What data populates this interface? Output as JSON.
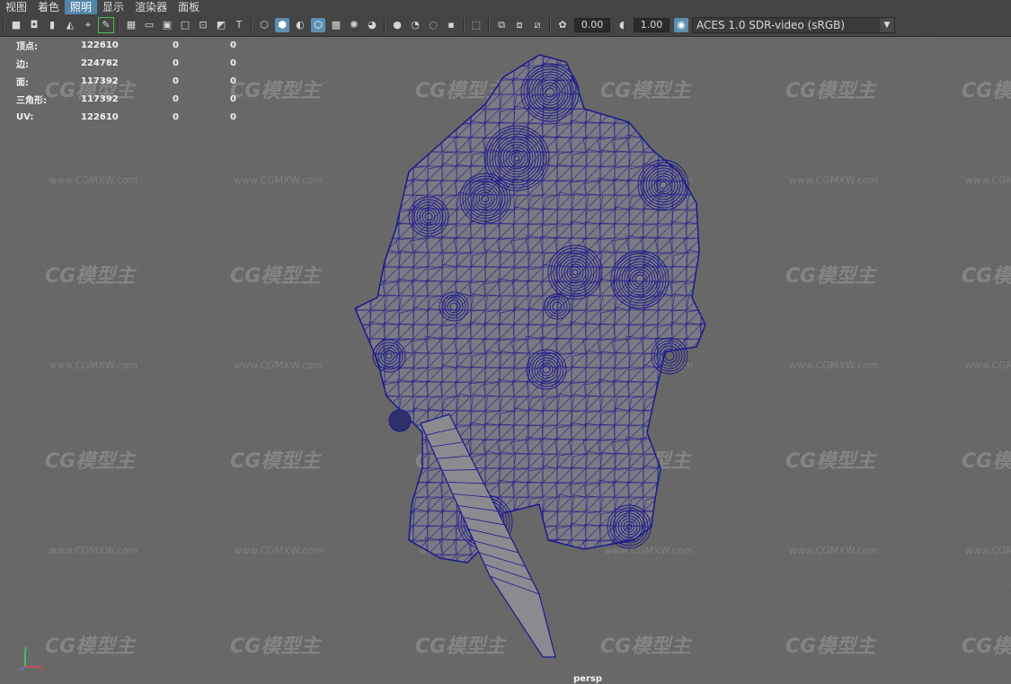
{
  "menubar": {
    "items": [
      "视图",
      "着色",
      "照明",
      "显示",
      "渲染器",
      "面板"
    ],
    "active_index": 2
  },
  "toolbar": {
    "gamma_value": "0.00",
    "exposure_value": "1.00",
    "color_space": "ACES 1.0 SDR-video (sRGB)"
  },
  "hud": {
    "rows": [
      {
        "label": "顶点:",
        "v1": "122610",
        "v2": "0",
        "v3": "0"
      },
      {
        "label": "边:",
        "v1": "224782",
        "v2": "0",
        "v3": "0"
      },
      {
        "label": "面:",
        "v1": "117392",
        "v2": "0",
        "v3": "0"
      },
      {
        "label": "三角形:",
        "v1": "117392",
        "v2": "0",
        "v3": "0"
      },
      {
        "label": "UV:",
        "v1": "122610",
        "v2": "0",
        "v3": "0"
      }
    ]
  },
  "viewport": {
    "camera": "persp",
    "watermark_logo": "CG模型主",
    "watermark_url": "www.CGMXW.com",
    "wire_color": "#1a1a8c"
  },
  "axis": {
    "x": "x",
    "y": "y",
    "z": "z"
  }
}
